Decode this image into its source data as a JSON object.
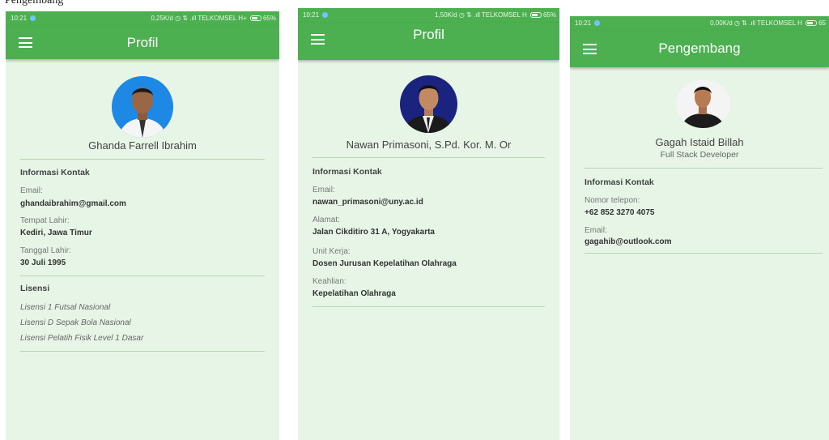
{
  "caption": "Pengembang",
  "colors": {
    "primary": "#4caf50",
    "background": "#e6f5e6"
  },
  "screens": [
    {
      "status": {
        "time": "10:21",
        "right": "0,25K/d ◷ ⇅ .ıll TELKOMSEL H+",
        "battery": "65%"
      },
      "title": "Profil",
      "name": "Ghanda Farrell Ibrahim",
      "contact_title": "Informasi Kontak",
      "fields": [
        {
          "label": "Email:",
          "value": "ghandaibrahim@gmail.com"
        },
        {
          "label": "Tempat Lahir:",
          "value": "Kediri, Jawa Timur"
        },
        {
          "label": "Tanggal Lahir:",
          "value": "30 Juli 1995"
        }
      ],
      "license_title": "Lisensi",
      "licenses": [
        "Lisensi 1 Futsal Nasional",
        "Lisensi D Sepak Bola Nasional",
        "Lisensi Pelatih Fisik Level 1 Dasar"
      ]
    },
    {
      "status": {
        "time": "10:21",
        "right": "1,50K/d ◷ ⇅ .ıll TELKOMSEL H",
        "battery": "65%"
      },
      "title": "Profil",
      "name": "Nawan Primasoni, S.Pd. Kor. M. Or",
      "contact_title": "Informasi Kontak",
      "fields": [
        {
          "label": "Email:",
          "value": "nawan_primasoni@uny.ac.id"
        },
        {
          "label": "Alamat:",
          "value": "Jalan Cikditiro 31 A, Yogyakarta"
        },
        {
          "label": "Unit Kerja:",
          "value": "Dosen Jurusan Kepelatihan Olahraga"
        },
        {
          "label": "Keahlian:",
          "value": "Kepelatihan Olahraga"
        }
      ]
    },
    {
      "status": {
        "time": "10:21",
        "right": "0,00K/d ◷ ⇅ .ıll TELKOMSEL H",
        "battery": "65"
      },
      "title": "Pengembang",
      "name": "Gagah Istaid Billah",
      "role": "Full Stack Developer",
      "contact_title": "Informasi Kontak",
      "fields": [
        {
          "label": "Nomor telepon:",
          "value": "+62 852 3270 4075"
        },
        {
          "label": "Email:",
          "value": "gagahib@outlook.com"
        }
      ]
    }
  ]
}
